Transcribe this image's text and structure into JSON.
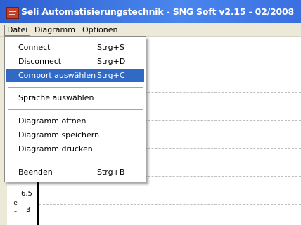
{
  "window": {
    "title": "Seli Automatisierungstechnik - SNG Soft v2.15 - 02/2008"
  },
  "menubar": {
    "datei": "Datei",
    "diagramm": "Diagramm",
    "optionen": "Optionen"
  },
  "datei_menu": {
    "connect": {
      "label": "Connect",
      "shortcut": "Strg+S"
    },
    "disconnect": {
      "label": "Disconnect",
      "shortcut": "Strg+D"
    },
    "comport": {
      "label": "Comport auswählen",
      "shortcut": "Strg+C"
    },
    "sprache": {
      "label": "Sprache auswählen"
    },
    "diagramm_oeffnen": {
      "label": "Diagramm öffnen"
    },
    "diagramm_speichern": {
      "label": "Diagramm speichern"
    },
    "diagramm_drucken": {
      "label": "Diagramm drucken"
    },
    "beenden": {
      "label": "Beenden",
      "shortcut": "Strg+B"
    }
  },
  "chart_area": {
    "tick_upper": "6,5",
    "tick_lower": "3",
    "axis_letters": [
      "e",
      "t"
    ]
  },
  "colors": {
    "highlight": "#316ac5",
    "titlebar": "#3a6fe0"
  }
}
